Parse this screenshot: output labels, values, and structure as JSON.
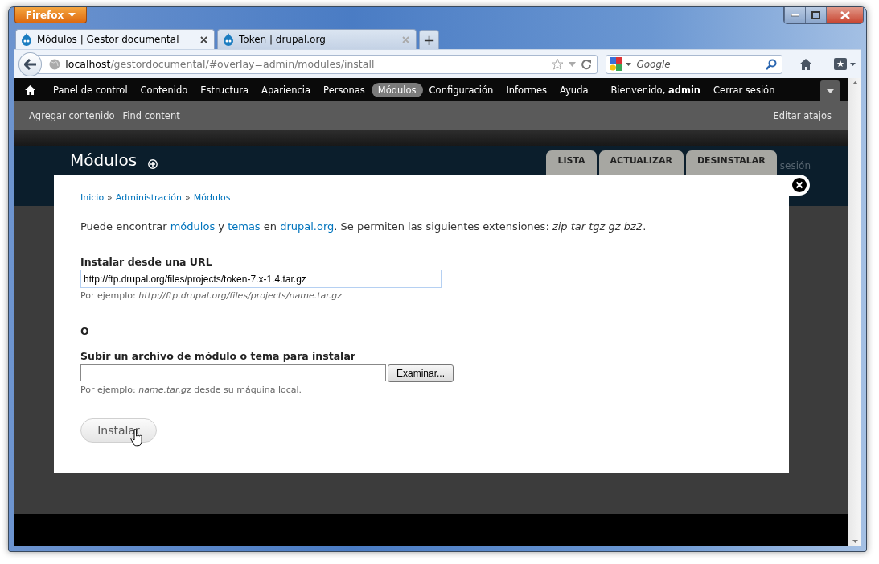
{
  "browser": {
    "menu_button": "Firefox",
    "tabs": [
      {
        "title": "Módulos | Gestor documental",
        "selected": true
      },
      {
        "title": "Token | drupal.org",
        "selected": false
      }
    ],
    "new_tab": "+",
    "url": {
      "host": "localhost",
      "path": "/gestordocumental/#overlay=admin/modules/install"
    },
    "search": {
      "placeholder": "Google"
    }
  },
  "toolbar": {
    "items": [
      {
        "label": "Panel de control",
        "selected": false
      },
      {
        "label": "Contenido",
        "selected": false
      },
      {
        "label": "Estructura",
        "selected": false
      },
      {
        "label": "Apariencia",
        "selected": false
      },
      {
        "label": "Personas",
        "selected": false
      },
      {
        "label": "Módulos",
        "selected": true
      },
      {
        "label": "Configuración",
        "selected": false
      },
      {
        "label": "Informes",
        "selected": false
      },
      {
        "label": "Ayuda",
        "selected": false
      }
    ],
    "welcome": "Bienvenido, **admin**",
    "logout": "Cerrar sesión"
  },
  "shortcuts": {
    "items": [
      "Agregar contenido",
      "Find content"
    ],
    "edit": "Editar atajos"
  },
  "page": {
    "title": "Módulos",
    "hidden_text": "sesión",
    "tabs": [
      {
        "label": "LISTA",
        "selected": false
      },
      {
        "label": "ACTUALIZAR",
        "selected": false
      },
      {
        "label": "DESINSTALAR",
        "selected": false
      }
    ]
  },
  "overlay": {
    "breadcrumb": {
      "separator": "»",
      "items": [
        "Inicio",
        "Administración",
        "Módulos"
      ]
    },
    "intro": [
      {
        "kind": "text",
        "text": "Puede encontrar "
      },
      {
        "kind": "link",
        "text": "módulos"
      },
      {
        "kind": "text",
        "text": " y "
      },
      {
        "kind": "link",
        "text": "temas"
      },
      {
        "kind": "text",
        "text": " en "
      },
      {
        "kind": "link",
        "text": "drupal.org"
      },
      {
        "kind": "text",
        "text": ". Se permiten las siguientes extensiones: *zip tar tgz gz bz2*."
      }
    ],
    "url_field": {
      "label": "Instalar desde una URL",
      "value": "http://ftp.drupal.org/files/projects/token-7.x-1.4.tar.gz",
      "description": "Por ejemplo: *http://ftp.drupal.org/files/projects/name.tar.gz*"
    },
    "or": "O",
    "upload_field": {
      "label": "Subir un archivo de módulo o tema para instalar",
      "browse": "Examinar...",
      "description": "Por ejemplo: *name.tar.gz* desde su máquina local."
    },
    "submit": "Instalar"
  }
}
